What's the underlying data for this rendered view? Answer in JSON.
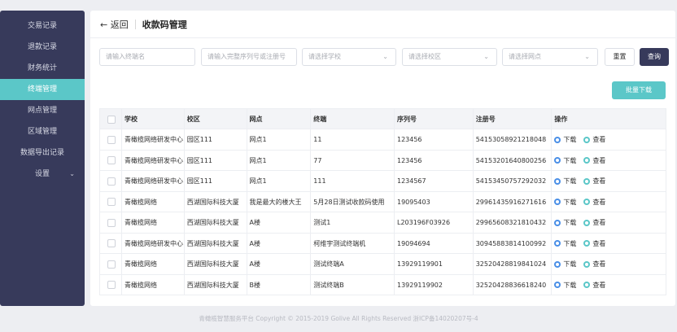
{
  "sidebar": {
    "items": [
      {
        "label": "交易记录"
      },
      {
        "label": "退款记录"
      },
      {
        "label": "财务统计"
      },
      {
        "label": "终端管理"
      },
      {
        "label": "网点管理"
      },
      {
        "label": "区域管理"
      },
      {
        "label": "数据导出记录"
      },
      {
        "label": "设置"
      }
    ],
    "active": "终端管理"
  },
  "header": {
    "back_label": "← 返回",
    "title": "收款码管理"
  },
  "filters": {
    "terminal_name_placeholder": "请输入终端名",
    "serial_placeholder": "请输入完整序列号或注册号",
    "school_placeholder": "请选择学校",
    "campus_placeholder": "请选择校区",
    "outlet_placeholder": "请选择网点",
    "reset_label": "重置",
    "query_label": "查询"
  },
  "batch_download_label": "批量下载",
  "table": {
    "columns": [
      "学校",
      "校区",
      "网点",
      "终端",
      "序列号",
      "注册号",
      "操作"
    ],
    "download_label": "下载",
    "view_label": "查看",
    "rows": [
      {
        "school": "青橄榄网络研发中心",
        "campus": "园区111",
        "outlet": "网点1",
        "terminal": "11",
        "serial": "123456",
        "reg": "54153058921218048"
      },
      {
        "school": "青橄榄网络研发中心",
        "campus": "园区111",
        "outlet": "网点1",
        "terminal": "77",
        "serial": "123456",
        "reg": "54153201640800256"
      },
      {
        "school": "青橄榄网络研发中心",
        "campus": "园区111",
        "outlet": "网点1",
        "terminal": "111",
        "serial": "1234567",
        "reg": "54153450757292032"
      },
      {
        "school": "青橄榄网络",
        "campus": "西湖国际科技大厦",
        "outlet": "我是最大的楼大王",
        "terminal": "5月28日测试收款码使用",
        "serial": "19095403",
        "reg": "29961435916271616"
      },
      {
        "school": "青橄榄网络",
        "campus": "西湖国际科技大厦",
        "outlet": "A楼",
        "terminal": "测试1",
        "serial": "L203196F03926",
        "reg": "29965608321810432"
      },
      {
        "school": "青橄榄网络研发中心",
        "campus": "西湖国际科技大厦",
        "outlet": "A楼",
        "terminal": "柯维宇测试终端机",
        "serial": "19094694",
        "reg": "30945883814100992"
      },
      {
        "school": "青橄榄网络",
        "campus": "西湖国际科技大厦",
        "outlet": "A楼",
        "terminal": "测试终端A",
        "serial": "13929119901",
        "reg": "32520428819841024"
      },
      {
        "school": "青橄榄网络",
        "campus": "西湖国际科技大厦",
        "outlet": "B楼",
        "terminal": "测试终端B",
        "serial": "13929119902",
        "reg": "32520428836618240"
      }
    ]
  },
  "footer": "青橄榄智慧服务平台 Copyright © 2015-2019 Golive All Rights Reserved  浙ICP备14020207号-4",
  "colors": {
    "sidebar": "#373a5b",
    "accent": "#5bc7c8",
    "download_icon": "#4a8fe7"
  }
}
